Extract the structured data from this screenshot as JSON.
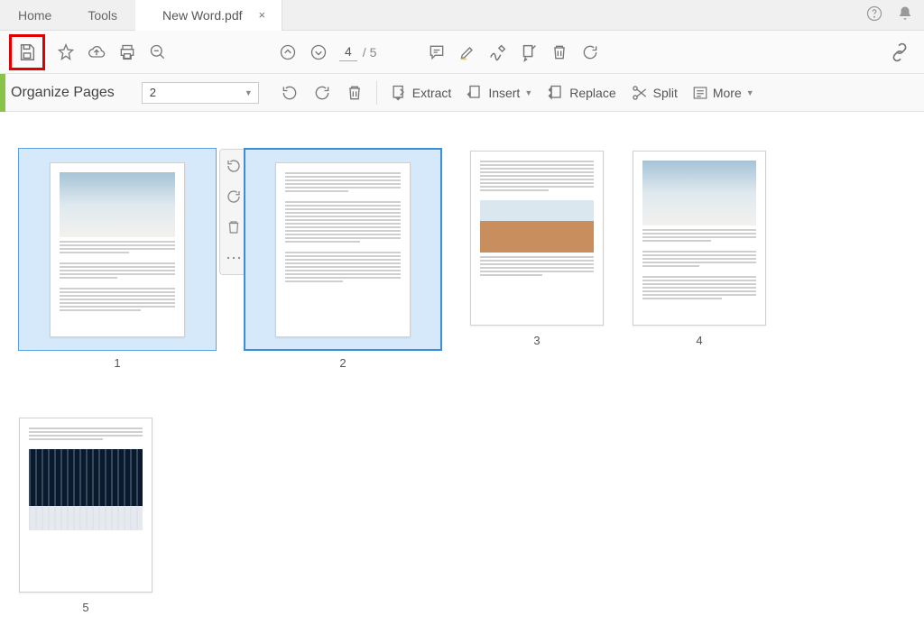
{
  "tabs": {
    "home": "Home",
    "tools": "Tools",
    "doc_title": "New  Word.pdf",
    "close_glyph": "×"
  },
  "toolbar1": {
    "page_current": "4",
    "page_total": "/  5"
  },
  "toolbar2": {
    "title": "Organize Pages",
    "select_value": "2",
    "extract": "Extract",
    "insert": "Insert",
    "replace": "Replace",
    "split": "Split",
    "more": "More"
  },
  "thumbs": {
    "labels": [
      "1",
      "2",
      "3",
      "4",
      "5"
    ]
  }
}
